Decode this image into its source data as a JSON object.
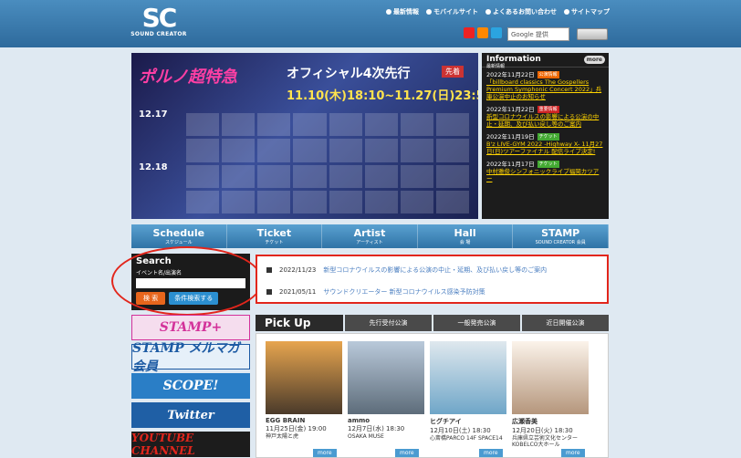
{
  "header": {
    "logo_mark": "SC",
    "logo_text": "SOUND CREATOR",
    "links": [
      "最新情報",
      "モバイルサイト",
      "よくあるお問い合わせ",
      "サイトマップ"
    ],
    "search_placeholder": "Google 提供"
  },
  "hero": {
    "logo": "ポルノ超特急",
    "title": "オフィシャル4次先行",
    "badge": "先着",
    "date": "11.10(木)18:10~11.27(日)23:59",
    "day1": "12.17",
    "day2": "12.18"
  },
  "information": {
    "title": "Information",
    "subtitle": "最新情報",
    "more": "more",
    "items": [
      {
        "date": "2022年11月22日",
        "tag": "公演情報",
        "text": "「billboard classics The Gospellers Premium Symphonic Concert 2022」兵庫公演中止のお知らせ"
      },
      {
        "date": "2022年11月22日",
        "tag": "重要情報",
        "text": "新型コロナウイルスの影響による公演の中止・延期、及び払い戻し等のご案内"
      },
      {
        "date": "2022年11月19日",
        "tag": "チケット",
        "text": "B'z LIVE-GYM 2022 -Highway X- 11月27日(日)ツアーファイナル 配信ライブ決定!"
      },
      {
        "date": "2022年11月17日",
        "tag": "チケット",
        "text": "中村雅俊シンフォニックライブ福岡カツアー"
      }
    ]
  },
  "nav": [
    {
      "label": "Schedule",
      "sub": "スケジュール"
    },
    {
      "label": "Ticket",
      "sub": "チケット"
    },
    {
      "label": "Artist",
      "sub": "アーティスト"
    },
    {
      "label": "Hall",
      "sub": "会 場"
    },
    {
      "label": "STAMP",
      "sub": "SOUND CREATOR 会員"
    }
  ],
  "search": {
    "title": "Search",
    "label": "イベント名/出演名",
    "btn_search": "検 索",
    "btn_adv": "条件検索する"
  },
  "banners": [
    "STAMP+",
    "STAMP メルマガ会員",
    "SCOPE!",
    "Twitter",
    "YOUTUBE CHANNEL"
  ],
  "notices": [
    {
      "date": "2022/11/23",
      "text": "新型コロナウイルスの影響による公演の中止・延期、及び払い戻し等のご案内"
    },
    {
      "date": "2021/05/11",
      "text": "サウンドクリエーター 新型コロナウイルス感染予防対策"
    }
  ],
  "pickup": {
    "title": "Pick Up",
    "tabs": [
      "先行受付公演",
      "一般発売公演",
      "近日開催公演"
    ],
    "more": "more",
    "cards": [
      {
        "name": "EGG BRAIN",
        "date": "11月25日(金) 19:00",
        "venue": "神戸太陽と虎"
      },
      {
        "name": "ammo",
        "date": "12月7日(水) 18:30",
        "venue": "OSAKA MUSE"
      },
      {
        "name": "ヒグチアイ",
        "date": "12月10日(土) 18:30",
        "venue": "心斎橋PARCO 14F SPACE14"
      },
      {
        "name": "広瀬香美",
        "date": "12月20日(火) 18:30",
        "venue": "兵庫県立芸術文化センター KOBELCO大ホール"
      }
    ]
  }
}
